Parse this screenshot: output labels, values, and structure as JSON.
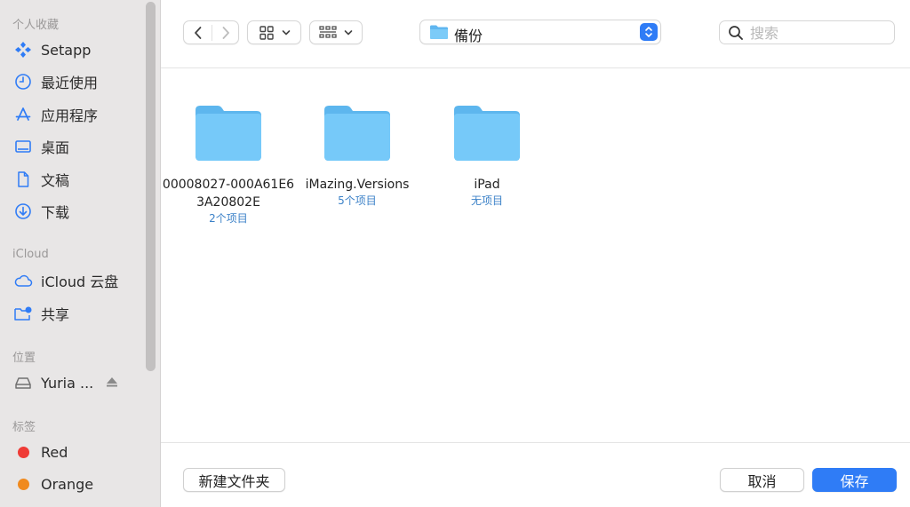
{
  "sidebar": {
    "sections": {
      "favorites": "个人收藏",
      "icloud": "iCloud",
      "locations": "位置",
      "tags": "标签"
    },
    "favorites": [
      {
        "label": "Setapp",
        "icon": "setapp-icon"
      },
      {
        "label": "最近使用",
        "icon": "clock-icon"
      },
      {
        "label": "应用程序",
        "icon": "applications-icon"
      },
      {
        "label": "桌面",
        "icon": "desktop-icon"
      },
      {
        "label": "文稿",
        "icon": "document-icon"
      },
      {
        "label": "下载",
        "icon": "download-icon"
      }
    ],
    "icloud": [
      {
        "label": "iCloud 云盘",
        "icon": "cloud-icon"
      },
      {
        "label": "共享",
        "icon": "shared-folder-icon"
      }
    ],
    "locations": [
      {
        "label": "Yuria ...",
        "icon": "disk-icon"
      }
    ],
    "tags": [
      {
        "label": "Red",
        "color": "#ef3b36"
      },
      {
        "label": "Orange",
        "color": "#f08a1e"
      }
    ]
  },
  "toolbar": {
    "path_label": "備份",
    "search_placeholder": "搜索"
  },
  "items": [
    {
      "name": "00008027-000A61E63A20802E",
      "count": "2个项目"
    },
    {
      "name": "iMazing.Versions",
      "count": "5个项目"
    },
    {
      "name": "iPad",
      "count": "无项目"
    }
  ],
  "footer": {
    "new_folder": "新建文件夹",
    "cancel": "取消",
    "save": "保存"
  },
  "colors": {
    "accent": "#2f7cf6",
    "folder": "#6cc0f5",
    "sidebar_icon": "#2f7cf6"
  }
}
